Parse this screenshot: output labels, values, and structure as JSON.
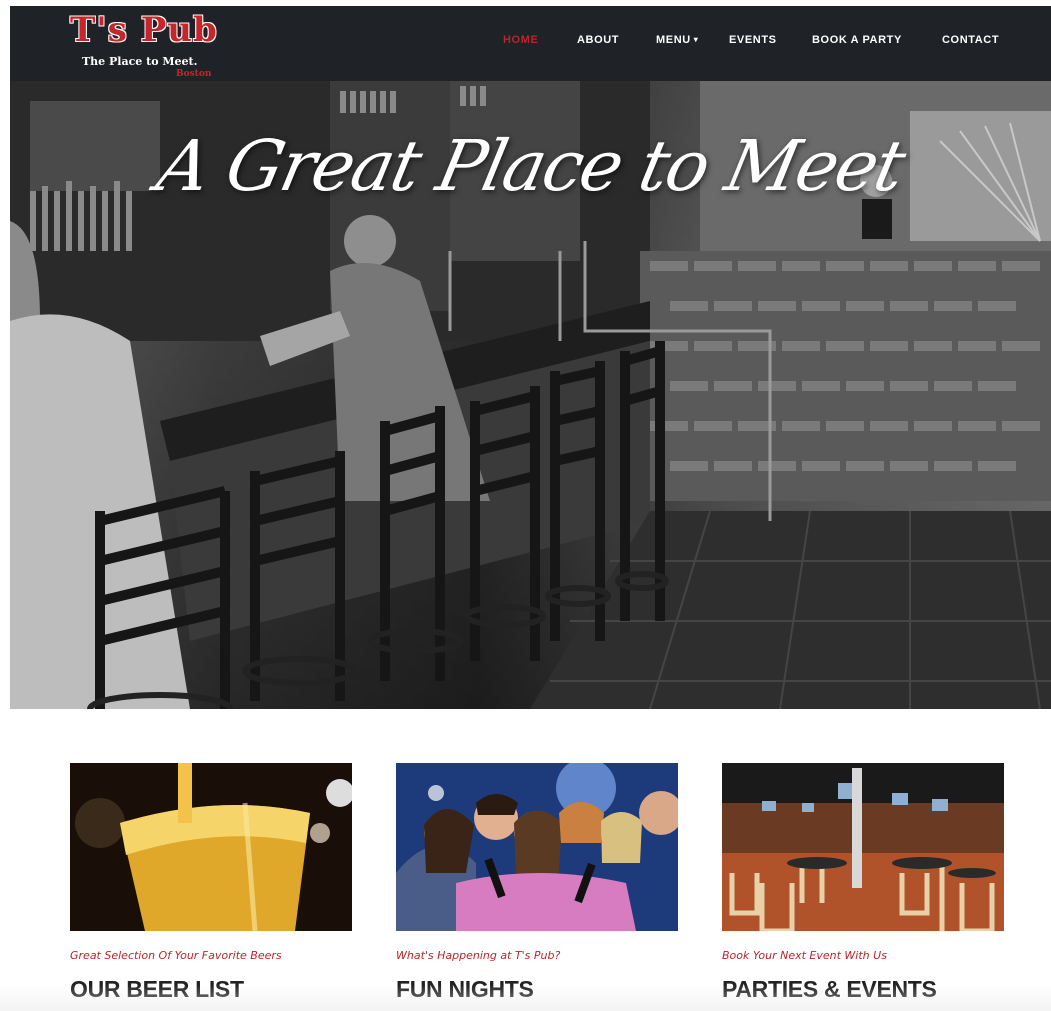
{
  "brand": {
    "name": "T's Pub",
    "tagline": "The Place to Meet.",
    "city": "Boston"
  },
  "nav": {
    "items": [
      {
        "label": "HOME",
        "active": true
      },
      {
        "label": "ABOUT",
        "active": false
      },
      {
        "label": "MENU",
        "active": false,
        "has_dropdown": true,
        "dropdown_icon": "chevron-down-icon"
      },
      {
        "label": "EVENTS",
        "active": false
      },
      {
        "label": "BOOK A PARTY",
        "active": false
      },
      {
        "label": "CONTACT",
        "active": false
      }
    ]
  },
  "hero": {
    "tagline": "A Great Place to Meet"
  },
  "cards": [
    {
      "kicker": "Great Selection Of Your Favorite Beers",
      "title": "OUR BEER LIST"
    },
    {
      "kicker": "What's Happening at T's Pub?",
      "title": "FUN NIGHTS"
    },
    {
      "kicker": "Book Your Next Event With Us",
      "title": "PARTIES & EVENTS"
    }
  ],
  "colors": {
    "accent": "#b8262b",
    "navbar": "#1f2227",
    "heading": "#222222"
  }
}
